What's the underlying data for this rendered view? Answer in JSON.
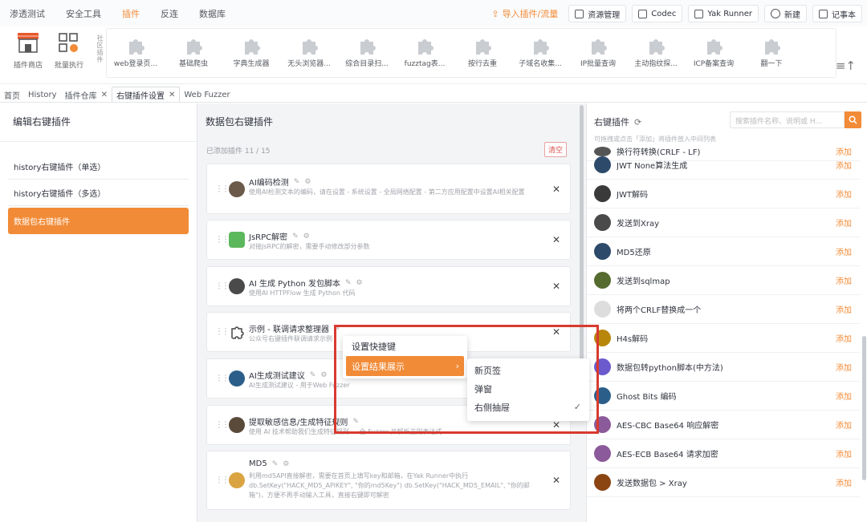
{
  "topbar": {
    "menus": [
      "渗透测试",
      "安全工具",
      "插件",
      "反连",
      "数据库"
    ],
    "active_menu": "插件",
    "import_label": "导入插件/流量",
    "buttons": [
      "资源管理",
      "Codec",
      "Yak Runner",
      "新建",
      "记事本"
    ]
  },
  "pluginbar": {
    "store_label": "插件商店",
    "exec_label": "批量执行",
    "vertical_label": "社区插件",
    "items": [
      "web登录页...",
      "基础爬虫",
      "字典生成器",
      "无头浏览器...",
      "综合目录扫...",
      "fuzztag表...",
      "按行去重",
      "子域名收集...",
      "IP批量查询",
      "主动指纹探...",
      "ICP备案查询",
      "翻一下"
    ]
  },
  "tabs": [
    {
      "label": "首页",
      "closable": false,
      "active": false
    },
    {
      "label": "History",
      "closable": false,
      "active": false
    },
    {
      "label": "插件仓库",
      "closable": true,
      "active": false
    },
    {
      "label": "右键插件设置",
      "closable": true,
      "active": true
    },
    {
      "label": "Web Fuzzer",
      "closable": false,
      "active": false
    }
  ],
  "left": {
    "title": "编辑右键插件",
    "items": [
      "history右键插件（单选）",
      "history右键插件（多选）",
      "数据包右键插件"
    ],
    "active_index": 2
  },
  "middle": {
    "title": "数据包右键插件",
    "count": "已添加插件 11 / 15",
    "clear_label": "清空",
    "cards": [
      {
        "title": "AI编码检测",
        "desc": "使用AI检测文本的编码，请在设置 - 系统设置 - 全局网络配置 - 第二方应用配置中设置AI相关配置"
      },
      {
        "title": "JsRPC解密",
        "desc": "对接JsRPC的解密，需要手动修改部分参数"
      },
      {
        "title": "AI 生成 Python 发包脚本",
        "desc": "使用AI HTTPFlow 生成 Python 代码"
      },
      {
        "title": "示例 - 联调请求整理器",
        "desc": "公众号右键插件联调请求示例"
      },
      {
        "title": "AI生成测试建议",
        "desc": "AI生成测试建议 - 用于Web Fuzzer"
      },
      {
        "title": "提取敏感信息/生成特征规则",
        "desc": "使用 AI 技术帮助我们生成特征规则 ... 全 Fuzzer 并解析正则表达式"
      },
      {
        "title": "MD5",
        "desc": "利用md5API直接解密，需要在首页上填写key和邮箱，在Yak Runner中执行 db.SetKey(\"HACK_MD5_APIKEY\", \"你的md5Key\") db.SetKey(\"HACK_MD5_EMAIL\", \"你的邮箱\")，方便不再手动输入工具，直接右键即可解密"
      }
    ]
  },
  "right": {
    "title": "右键插件",
    "search_placeholder": "搜索插件名称、说明或 H...",
    "hint": "可拖拽或点击「添加」将插件放入中间列表",
    "add_label": "添加",
    "items": [
      {
        "name": "换行符转换(CRLF - LF)",
        "color": "#555"
      },
      {
        "name": "JWT None算法生成",
        "color": "#2d4a6b"
      },
      {
        "name": "JWT解码",
        "color": "#3a3a3a"
      },
      {
        "name": "发送到Xray",
        "color": "#4a4a4a"
      },
      {
        "name": "MD5还原",
        "color": "#2d4a6b"
      },
      {
        "name": "发送到sqlmap",
        "color": "#556b2f"
      },
      {
        "name": "将两个CRLF替换成一个",
        "color": "#dddddd"
      },
      {
        "name": "H4s解码",
        "color": "#b8860b"
      },
      {
        "name": "数据包转python脚本(中方法)",
        "color": "#6a5acd"
      },
      {
        "name": "Ghost Bits 编码",
        "color": "#2b5f8a"
      },
      {
        "name": "AES-CBC Base64 响应解密",
        "color": "#8b5a9a"
      },
      {
        "name": "AES-ECB Base64 请求加密",
        "color": "#8b5a9a"
      },
      {
        "name": "发送数据包 > Xray",
        "color": "#8b4513"
      }
    ]
  },
  "context_menu": {
    "items": [
      "设置快捷键",
      "设置结果展示"
    ],
    "highlighted_index": 1,
    "submenu": [
      "新页签",
      "弹窗",
      "右侧抽屉"
    ],
    "checked_index": 2
  },
  "colors": {
    "accent": "#f28b37",
    "highlight_box": "#d83a2f"
  }
}
